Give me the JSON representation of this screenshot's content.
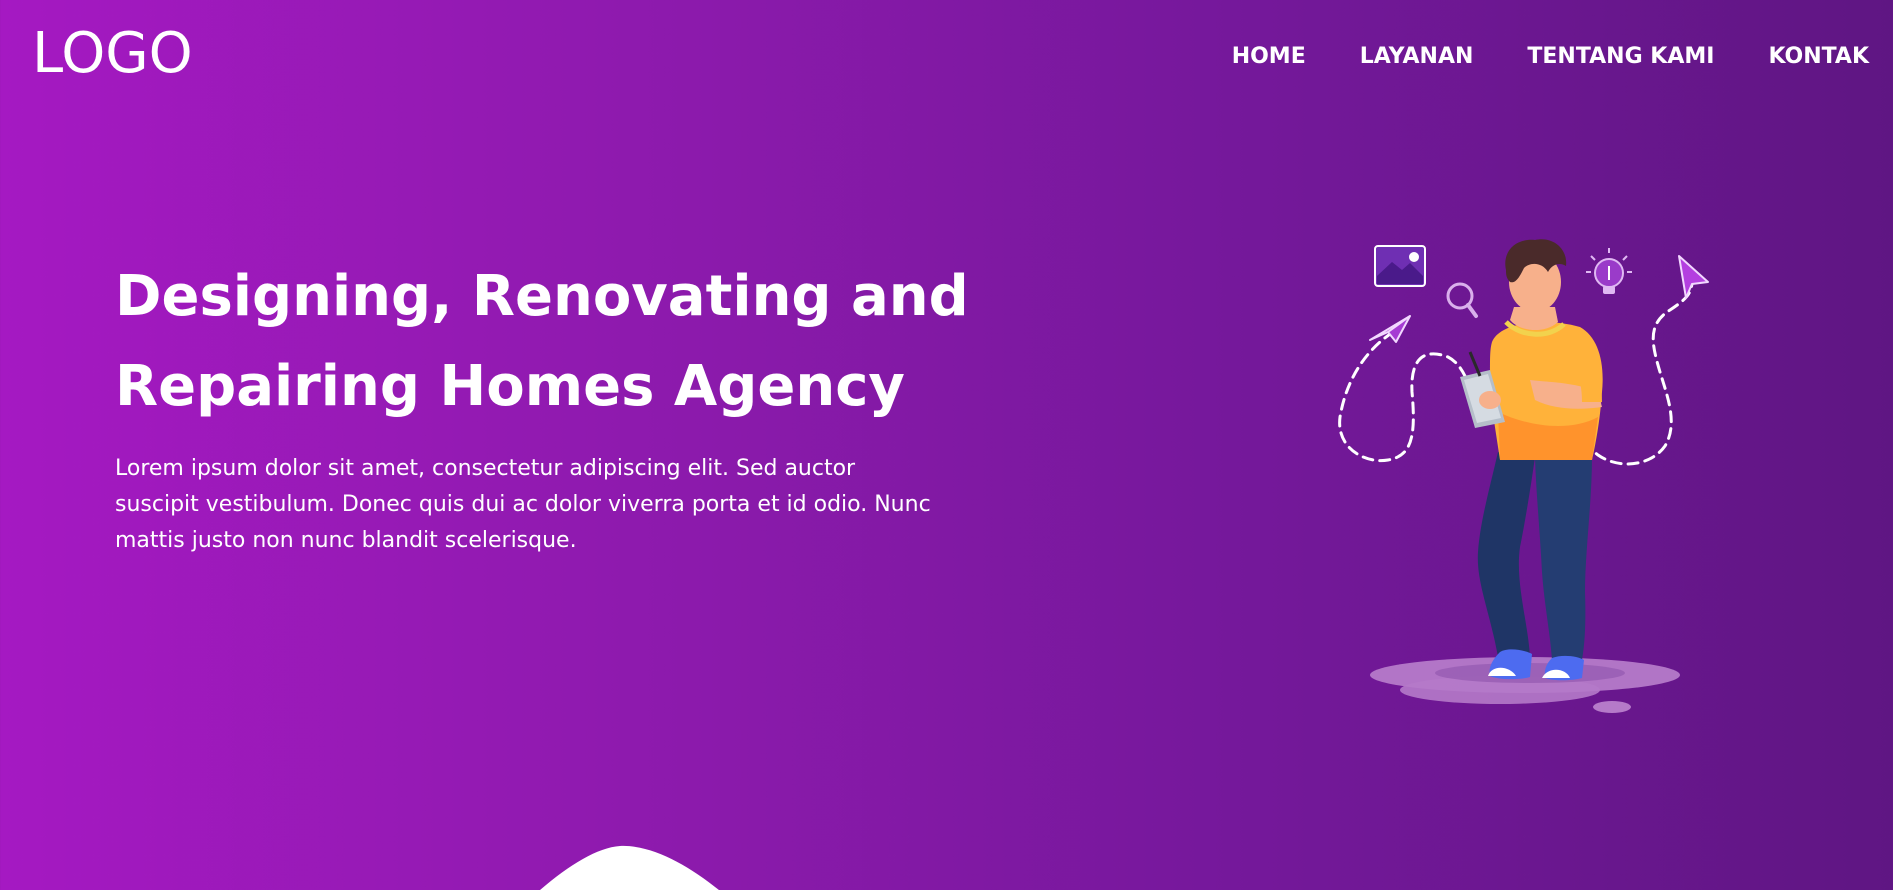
{
  "brand": {
    "logo_text": "LOGO"
  },
  "nav": {
    "items": [
      {
        "label": "HOME"
      },
      {
        "label": "LAYANAN"
      },
      {
        "label": "TENTANG KAMI"
      },
      {
        "label": "KONTAK"
      }
    ]
  },
  "hero": {
    "title": "Designing, Renovating and Repairing Homes Agency",
    "description": "Lorem ipsum dolor sit amet, consectetur adipiscing elit. Sed auctor suscipit vestibulum. Donec quis dui ac dolor viverra porta et id odio. Nunc mattis justo non nunc blandit scelerisque."
  },
  "illustration": {
    "icons": [
      "image-icon",
      "search-icon",
      "lightbulb-icon",
      "paper-plane-icon",
      "cursor-icon"
    ]
  }
}
